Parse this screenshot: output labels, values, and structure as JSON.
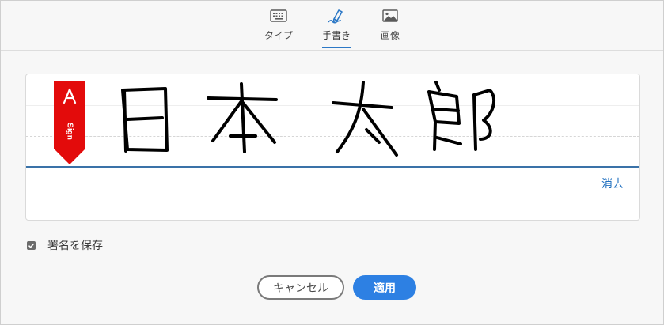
{
  "tabs": [
    {
      "label": "タイプ",
      "icon": "keyboard-icon",
      "active": false
    },
    {
      "label": "手書き",
      "icon": "pen-icon",
      "active": true
    },
    {
      "label": "画像",
      "icon": "image-icon",
      "active": false
    }
  ],
  "signature": {
    "ribbon_text": "Sign",
    "clear_label": "消去"
  },
  "save_signature": {
    "label": "署名を保存",
    "checked": true
  },
  "buttons": {
    "cancel_label": "キャンセル",
    "apply_label": "適用"
  },
  "colors": {
    "accent": "#2c78c6",
    "apply_button": "#2d80e3",
    "ribbon": "#e30b0b",
    "link": "#1f6fbf"
  }
}
